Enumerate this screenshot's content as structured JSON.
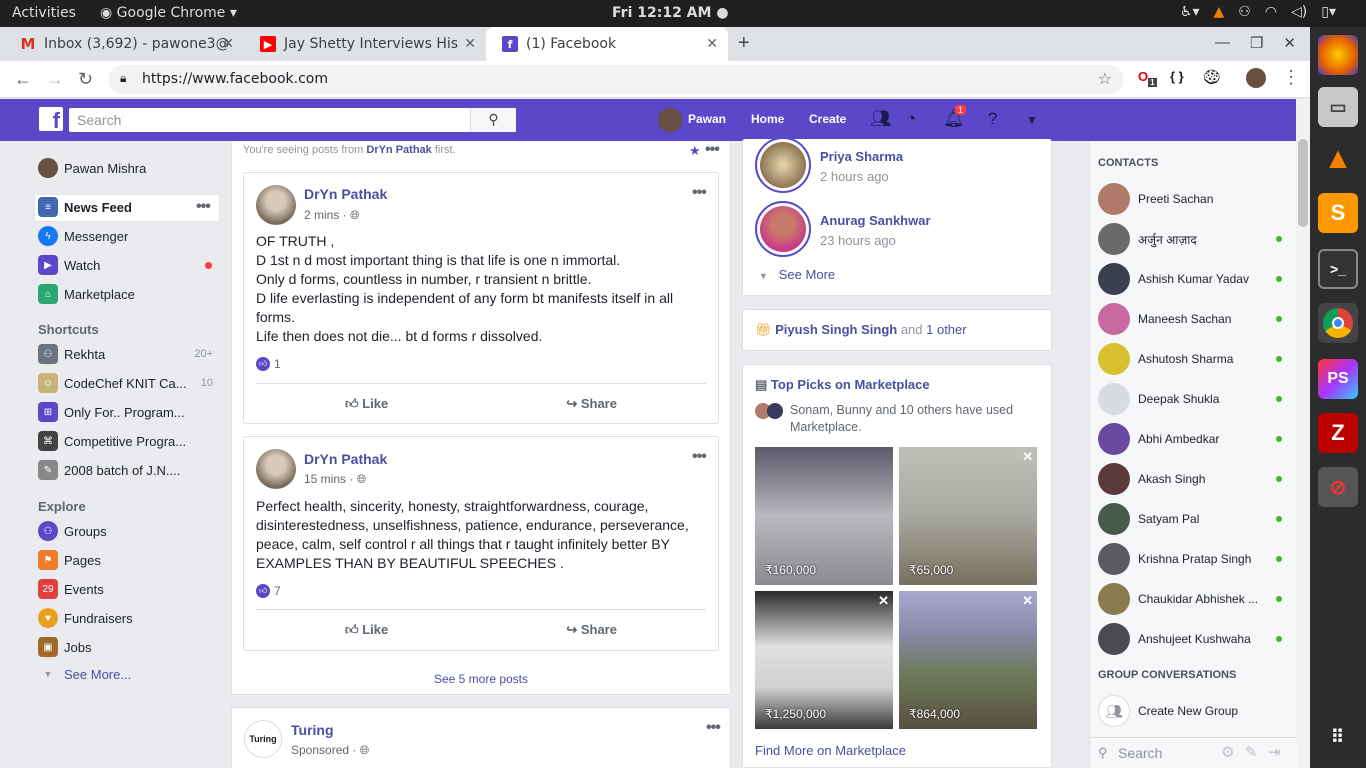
{
  "os": {
    "activities": "Activities",
    "app_name": "Google Chrome",
    "clock": "Fri 12:12 AM"
  },
  "tabs": [
    {
      "title": "Inbox (3,692) - pawone3@",
      "favicon": "gmail-icon"
    },
    {
      "title": "Jay Shetty Interviews His",
      "favicon": "youtube-icon"
    },
    {
      "title": "(1) Facebook",
      "favicon": "facebook-icon"
    }
  ],
  "browser": {
    "url": "https://www.facebook.com",
    "ext_badge": "1"
  },
  "fb": {
    "search_placeholder": "Search",
    "user": "Pawan",
    "home": "Home",
    "create": "Create",
    "notif_count": "1"
  },
  "left_nav": {
    "profile": "Pawan Mishra",
    "main": [
      {
        "label": "News Feed",
        "icon": "news-feed-icon",
        "color": "#4267b2"
      },
      {
        "label": "Messenger",
        "icon": "messenger-icon",
        "color": "#1877f2"
      },
      {
        "label": "Watch",
        "icon": "watch-icon",
        "color": "#5a48c8"
      },
      {
        "label": "Marketplace",
        "icon": "marketplace-icon",
        "color": "#2aa872"
      }
    ],
    "shortcuts_title": "Shortcuts",
    "shortcuts": [
      {
        "label": "Rekhta",
        "count": "20+",
        "color": "#6b7280"
      },
      {
        "label": "CodeChef KNIT Ca...",
        "count": "10",
        "color": "#c9b37a"
      },
      {
        "label": "Only For.. Program...",
        "count": "",
        "color": "#5a48c8"
      },
      {
        "label": "Competitive Progra...",
        "count": "",
        "color": "#444444"
      },
      {
        "label": "2008 batch of J.N....",
        "count": "",
        "color": "#888888"
      }
    ],
    "explore_title": "Explore",
    "explore": [
      {
        "label": "Groups",
        "icon": "groups-icon",
        "color": "#5a48c8"
      },
      {
        "label": "Pages",
        "icon": "pages-icon",
        "color": "#f07c2a"
      },
      {
        "label": "Events",
        "icon": "events-icon",
        "color": "#e04040"
      },
      {
        "label": "Fundraisers",
        "icon": "fundraisers-icon",
        "color": "#e8a020"
      },
      {
        "label": "Jobs",
        "icon": "jobs-icon",
        "color": "#a06a2a"
      }
    ],
    "see_more": "See More..."
  },
  "feed": {
    "notice_prefix": "You're seeing posts from ",
    "notice_name": "DrYn Pathak",
    "notice_suffix": " first.",
    "posts": [
      {
        "author": "DrYn Pathak",
        "time": "2 mins · ",
        "lines": [
          "OF TRUTH ,",
          "D 1st n d most important thing is that life is one n immortal.",
          "Only d forms, countless in number, r transient n brittle.",
          "D life everlasting is independent of any form bt manifests itself in all forms.",
          "Life then does not die... bt d forms r dissolved."
        ],
        "likes": "1"
      },
      {
        "author": "DrYn Pathak",
        "time": "15 mins · ",
        "lines": [
          "Perfect health, sincerity, honesty, straightforwardness, courage, disinterestedness, unselfishness, patience, endurance, perseverance, peace, calm, self control r all things that r taught infinitely better BY EXAMPLES THAN BY BEAUTIFUL SPEECHES ."
        ],
        "likes": "7"
      }
    ],
    "like": "Like",
    "share": "Share",
    "see_more_posts": "See 5 more posts",
    "sponsored": {
      "name": "Turing",
      "label": "Sponsored · ",
      "logo": "Turing"
    }
  },
  "stories": [
    {
      "name": "Priya Sharma",
      "time": "2 hours ago"
    },
    {
      "name": "Anurag Sankhwar",
      "time": "23 hours ago"
    }
  ],
  "stories_see_more": "See More",
  "birthday": {
    "name": "Piyush Singh Singh",
    "and": " and ",
    "other": "1 other"
  },
  "marketplace": {
    "title": "Top Picks on Marketplace",
    "used_by": "Sonam, Bunny and 10 others have used Marketplace.",
    "items": [
      {
        "price": "₹160,000",
        "color": "#7a7a80"
      },
      {
        "price": "₹65,000",
        "color": "#a8a8a0"
      },
      {
        "price": "₹1,250,000",
        "color": "#c8c8c8"
      },
      {
        "price": "₹864,000",
        "color": "#7d8a6a"
      }
    ],
    "find_more": "Find More on Marketplace"
  },
  "contacts": {
    "title": "CONTACTS",
    "list": [
      {
        "name": "Preeti Sachan",
        "online": false,
        "color": "#b07a6a"
      },
      {
        "name": "अर्जुन आज़ाद",
        "online": true,
        "color": "#6a6a6a"
      },
      {
        "name": "Ashish Kumar Yadav",
        "online": true,
        "color": "#3a4050"
      },
      {
        "name": "Maneesh Sachan",
        "online": true,
        "color": "#c86aa0"
      },
      {
        "name": "Ashutosh Sharma",
        "online": true,
        "color": "#d8c030"
      },
      {
        "name": "Deepak Shukla",
        "online": true,
        "color": "#d8dbe0"
      },
      {
        "name": "Abhi Ambedkar",
        "online": true,
        "color": "#6a4aa0"
      },
      {
        "name": "Akash Singh",
        "online": true,
        "color": "#5a3a3a"
      },
      {
        "name": "Satyam Pal",
        "online": true,
        "color": "#4a5a4a"
      },
      {
        "name": "Krishna Pratap Singh",
        "online": true,
        "color": "#5a5a60"
      },
      {
        "name": "Chaukidar Abhishek ...",
        "online": true,
        "color": "#8a7a50"
      },
      {
        "name": "Anshujeet Kushwaha",
        "online": true,
        "color": "#4a4a50"
      }
    ],
    "group_title": "GROUP CONVERSATIONS",
    "create_group": "Create New Group",
    "search_placeholder": "Search"
  }
}
